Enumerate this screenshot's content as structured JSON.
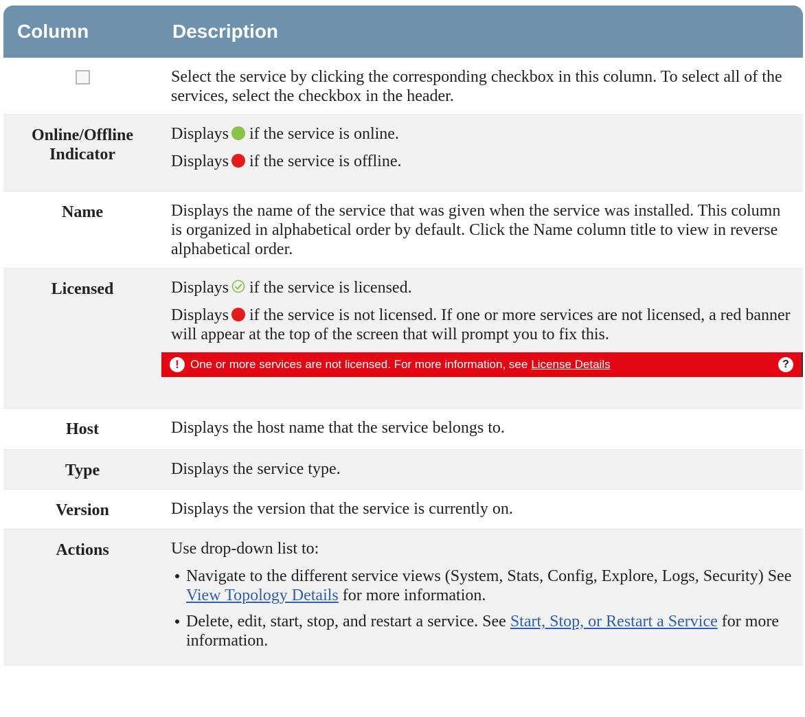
{
  "header": {
    "col1": "Column",
    "col2": "Description"
  },
  "rows": {
    "checkbox": {
      "desc": "Select the service by clicking the corresponding checkbox in this column. To select all of the services, select the checkbox in the header."
    },
    "online": {
      "label": "Online/Offline Indicator",
      "online_pre": "Displays",
      "online_post": "if the service is online.",
      "offline_pre": "Displays",
      "offline_post": "if the service is offline."
    },
    "name": {
      "label": "Name",
      "desc": "Displays the name of the service that was given when the service was installed. This column is organized in alphabetical order by default. Click the Name column title to view in reverse alphabetical order."
    },
    "licensed": {
      "label": "Licensed",
      "lic_pre": "Displays",
      "lic_post": "if the service is licensed.",
      "unlic_pre": "Displays",
      "unlic_post": "if the service is not licensed. If one or more services are not licensed, a red banner will appear at the top of the screen that will prompt you to fix this.",
      "banner_text": "One or more services are not licensed. For more information, see",
      "banner_link": "License Details"
    },
    "host": {
      "label": "Host",
      "desc": "Displays the host name that the service belongs to."
    },
    "type": {
      "label": "Type",
      "desc": "Displays the service type."
    },
    "version": {
      "label": "Version",
      "desc": "Displays the version that the service is currently on."
    },
    "actions": {
      "label": "Actions",
      "intro": "Use drop-down list to:",
      "item1_pre": "Navigate to the different service views (System, Stats, Config, Explore, Logs, Security) See",
      "item1_link": "View Topology Details",
      "item1_post": "for more information.",
      "item2_pre": "Delete, edit, start, stop, and restart a service. See",
      "item2_link": "Start, Stop, or Restart a Service",
      "item2_post": "for more information."
    }
  },
  "colors": {
    "header_bg": "#6e91ad",
    "online": "#8bc34a",
    "offline": "#e21c1c",
    "banner": "#e30613",
    "link": "#2f5fb0"
  }
}
